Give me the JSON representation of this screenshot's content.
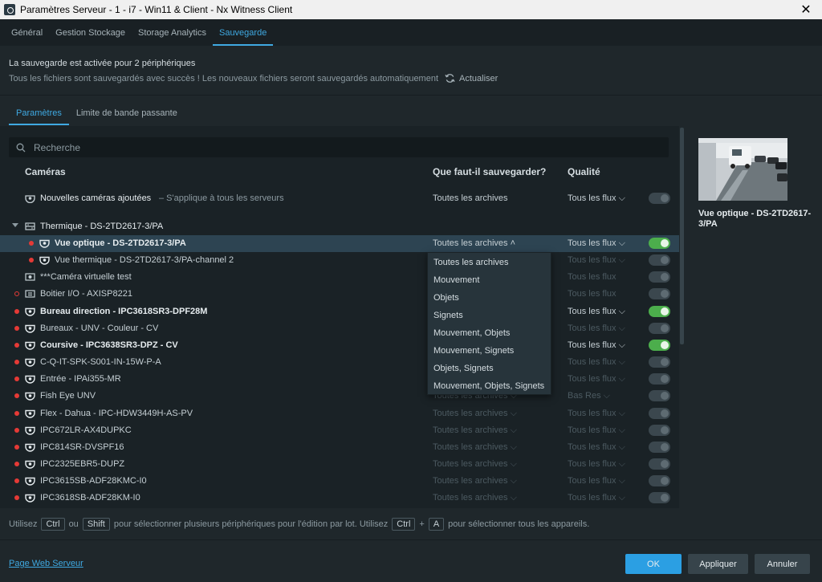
{
  "window": {
    "title": "Paramètres Serveur - 1 - i7 - Win11 & Client - Nx Witness Client",
    "close_glyph": "✕"
  },
  "main_tabs": [
    {
      "label": "Général",
      "active": false
    },
    {
      "label": "Gestion Stockage",
      "active": false
    },
    {
      "label": "Storage Analytics",
      "active": false
    },
    {
      "label": "Sauvegarde",
      "active": true
    }
  ],
  "backup_status": {
    "line1": "La sauvegarde est activée pour 2 périphériques",
    "line2": "Tous les fichiers sont sauvegardés avec succès ! Les nouveaux fichiers seront sauvegardés automatiquement",
    "refresh_label": "Actualiser"
  },
  "sub_tabs": [
    {
      "label": "Paramètres",
      "active": true
    },
    {
      "label": "Limite de bande passante",
      "active": false
    }
  ],
  "search": {
    "placeholder": "Recherche"
  },
  "columns": {
    "cameras": "Caméras",
    "what": "Que faut-il sauvegarder?",
    "quality": "Qualité"
  },
  "new_cameras": {
    "label": "Nouvelles caméras ajoutées",
    "note": "– S'applique à tous les serveurs",
    "what": "Toutes les archives",
    "quality": "Tous les flux ⌵",
    "enabled": false
  },
  "group": {
    "name": "Thermique - DS-2TD2617-3/PA"
  },
  "rows": [
    {
      "name": "Vue optique - DS-2TD2617-3/PA",
      "bold": true,
      "what": "Toutes les archives ˄",
      "quality": "Tous les flux ⌵",
      "enabled": true
    },
    {
      "name": "Vue thermique - DS-2TD2617-3/PA-channel 2",
      "bold": false,
      "what": "",
      "quality": "Tous les flux ⌵",
      "enabled": false
    },
    {
      "name": "***Caméra virtuelle test",
      "bold": false,
      "what": "",
      "quality": "Tous les flux",
      "enabled": false
    },
    {
      "name": "Boitier I/O - AXISP8221",
      "bold": false,
      "what": "",
      "quality": "Tous les flux",
      "enabled": false
    },
    {
      "name": "Bureau direction - IPC3618SR3-DPF28M",
      "bold": true,
      "what": "",
      "quality": "Tous les flux ⌵",
      "enabled": true
    },
    {
      "name": "Bureaux - UNV - Couleur - CV",
      "bold": false,
      "what": "",
      "quality": "Tous les flux ⌵",
      "enabled": false
    },
    {
      "name": "Coursive - IPC3638SR3-DPZ - CV",
      "bold": true,
      "what": "",
      "quality": "Tous les flux ⌵",
      "enabled": true
    },
    {
      "name": "C-Q-IT-SPK-S001-IN-15W-P-A",
      "bold": false,
      "what": "",
      "quality": "Tous les flux ⌵",
      "enabled": false
    },
    {
      "name": "Entrée - IPAi355-MR",
      "bold": false,
      "what": "",
      "quality": "Tous les flux ⌵",
      "enabled": false
    },
    {
      "name": "Fish Eye UNV",
      "bold": false,
      "what": "Toutes les archives ⌵",
      "quality": "Bas Res ⌵",
      "enabled": false
    },
    {
      "name": "Flex - Dahua - IPC-HDW3449H-AS-PV",
      "bold": false,
      "what": "Toutes les archives ⌵",
      "quality": "Tous les flux ⌵",
      "enabled": false
    },
    {
      "name": "IPC672LR-AX4DUPKC",
      "bold": false,
      "what": "Toutes les archives ⌵",
      "quality": "Tous les flux ⌵",
      "enabled": false
    },
    {
      "name": "IPC814SR-DVSPF16",
      "bold": false,
      "what": "Toutes les archives ⌵",
      "quality": "Tous les flux ⌵",
      "enabled": false
    },
    {
      "name": "IPC2325EBR5-DUPZ",
      "bold": false,
      "what": "Toutes les archives ⌵",
      "quality": "Tous les flux ⌵",
      "enabled": false
    },
    {
      "name": "IPC3615SB-ADF28KMC-I0",
      "bold": false,
      "what": "Toutes les archives ⌵",
      "quality": "Tous les flux ⌵",
      "enabled": false
    },
    {
      "name": "IPC3618SB-ADF28KM-I0",
      "bold": false,
      "what": "Toutes les archives ⌵",
      "quality": "Tous les flux ⌵",
      "enabled": false
    }
  ],
  "dropdown": [
    "Toutes les archives",
    "Mouvement",
    "Objets",
    "Signets",
    "Mouvement, Objets",
    "Mouvement, Signets",
    "Objets, Signets",
    "Mouvement, Objets, Signets"
  ],
  "hint": {
    "p1": "Utilisez",
    "k1": "Ctrl",
    "p2": "ou",
    "k2": "Shift",
    "p3": "pour sélectionner plusieurs périphériques pour l'édition par lot. Utilisez",
    "k3": "Ctrl",
    "p4": "+",
    "k4": "A",
    "p5": "pour sélectionner tous les appareils."
  },
  "preview": {
    "name": "Vue optique - DS-2TD2617-3/PA"
  },
  "footer": {
    "link": "Page Web Serveur",
    "ok": "OK",
    "apply": "Appliquer",
    "cancel": "Annuler"
  },
  "colors": {
    "accent": "#3fa9e2",
    "toggle_on": "#4cae4c",
    "status_dot": "#e53a36",
    "selected_row": "#2d4452"
  }
}
